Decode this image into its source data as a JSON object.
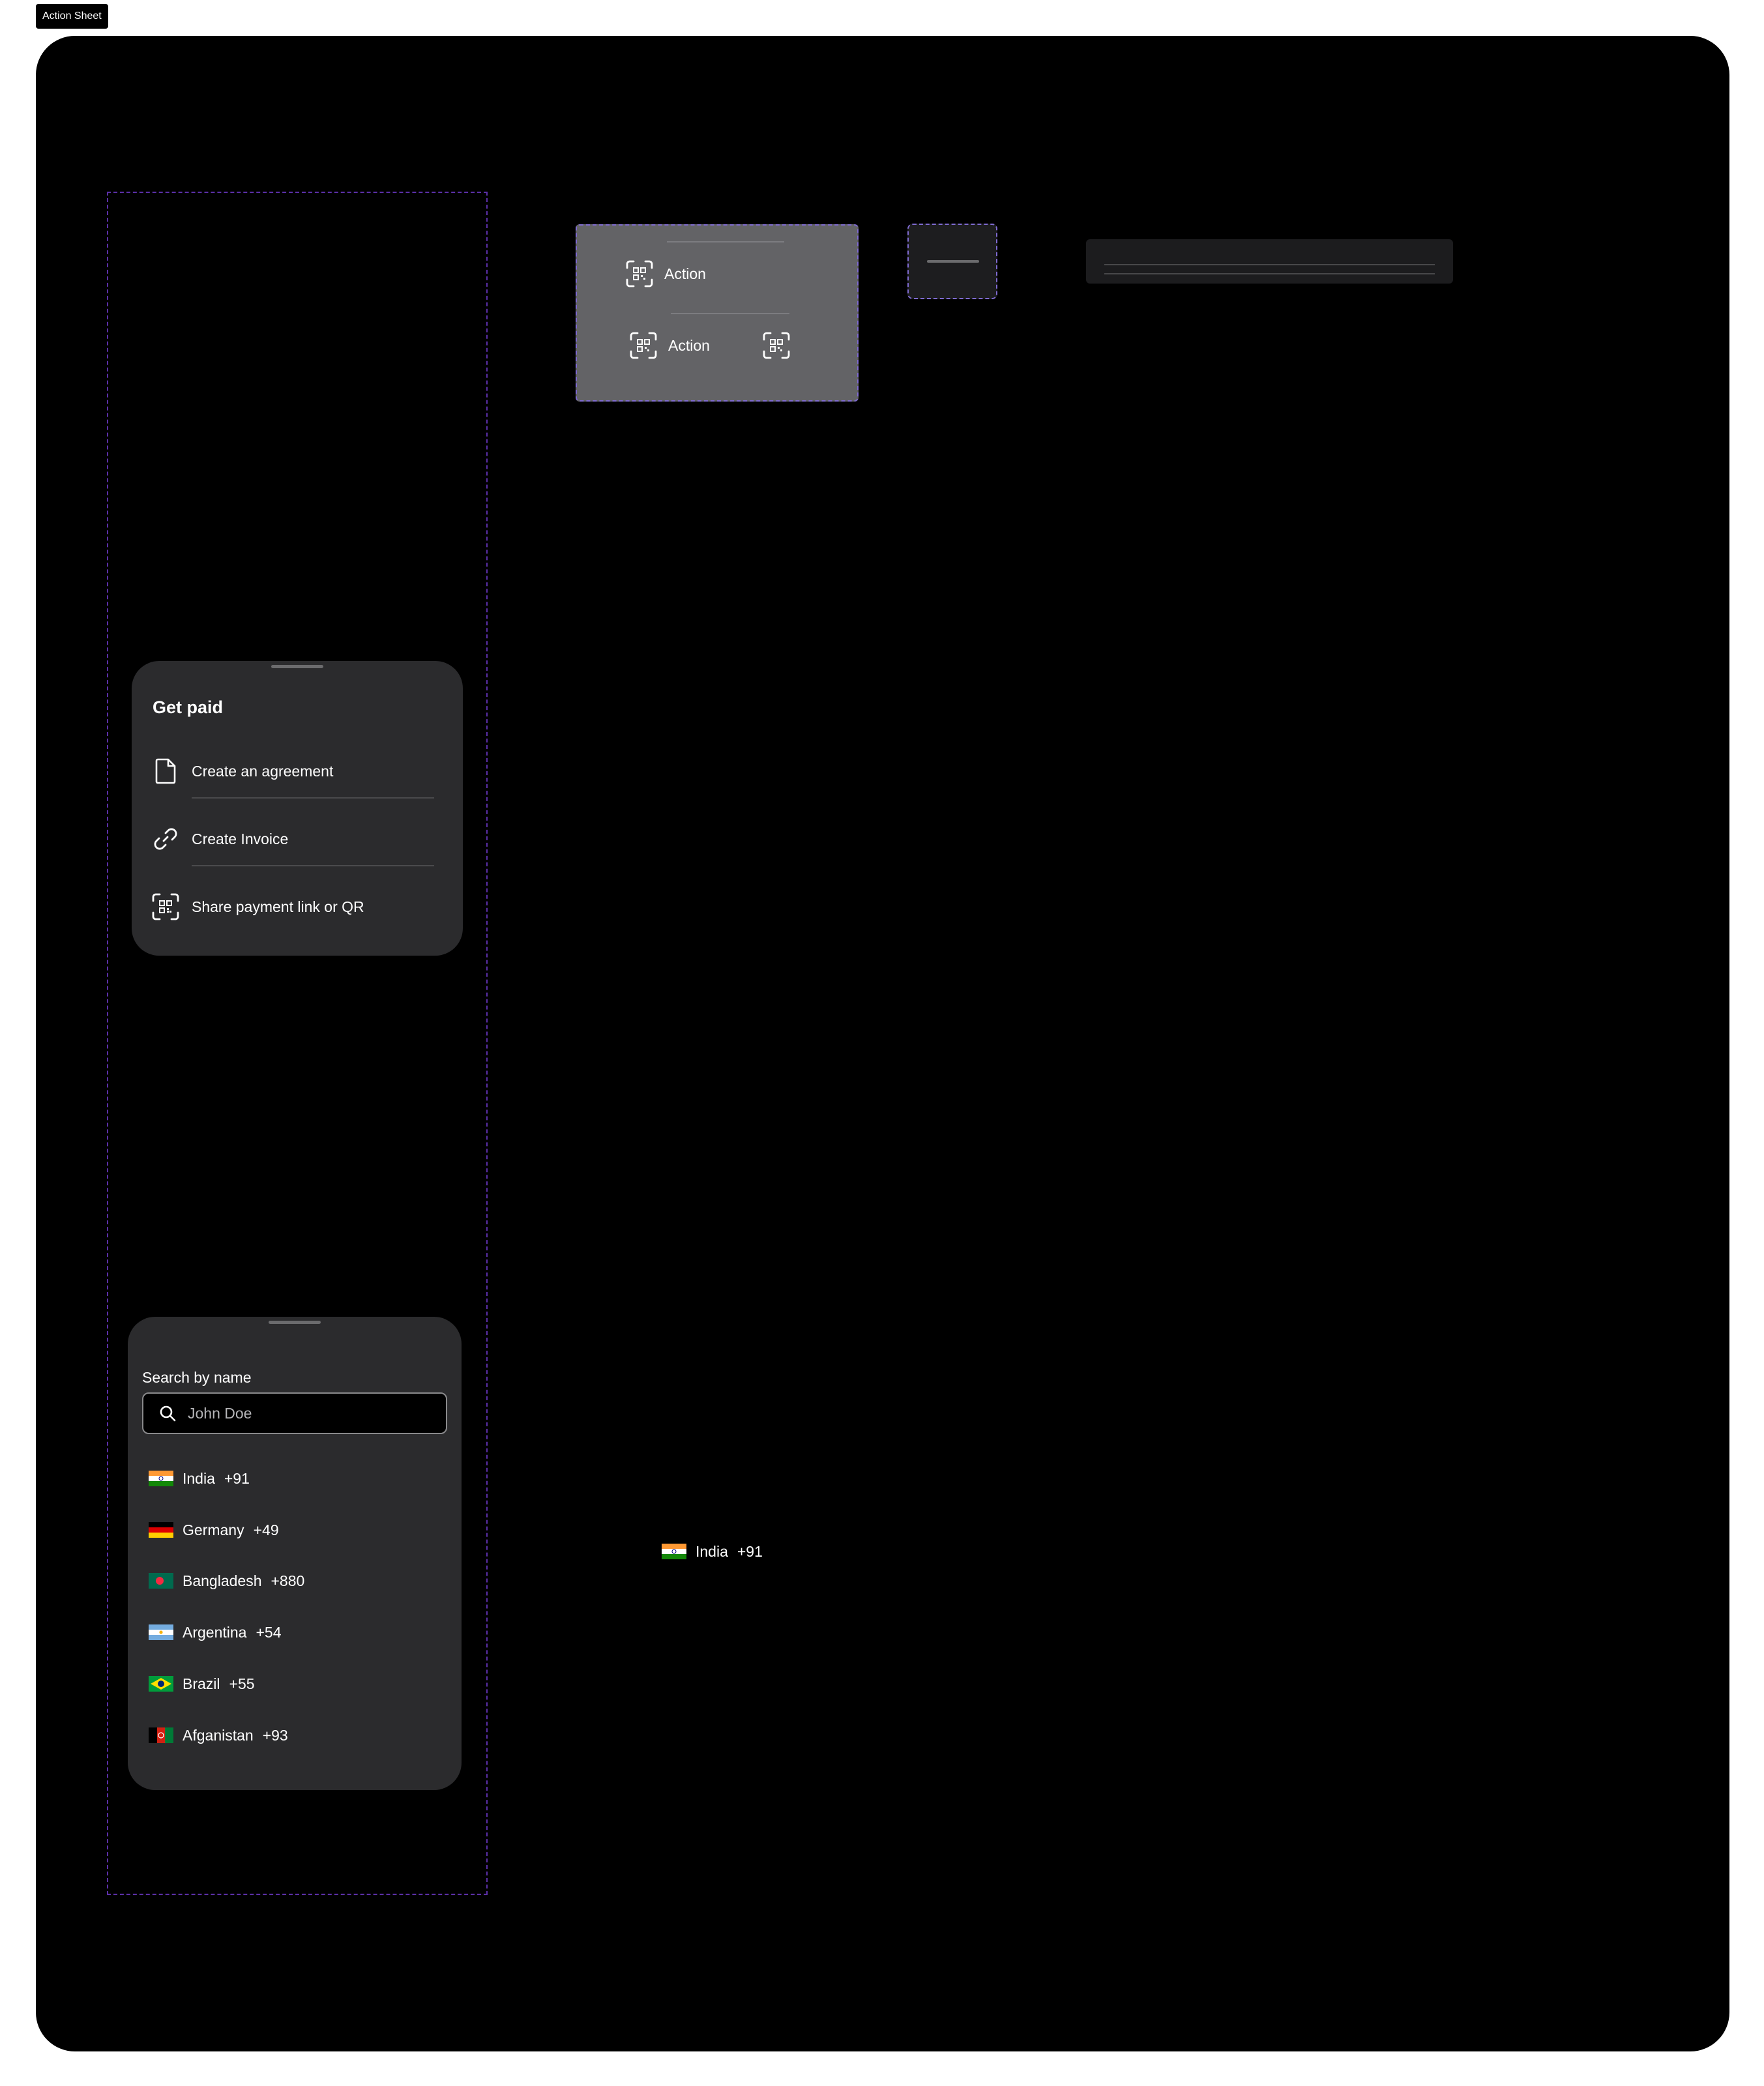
{
  "frame": {
    "label": "Action Sheet"
  },
  "get_paid_sheet": {
    "title": "Get paid",
    "items": [
      {
        "label": "Create an agreement",
        "icon": "document-icon"
      },
      {
        "label": "Create Invoice",
        "icon": "link-icon"
      },
      {
        "label": "Share payment link or QR",
        "icon": "qr-scan-icon"
      }
    ]
  },
  "country_sheet": {
    "search_label": "Search by name",
    "search_placeholder": "John Doe",
    "countries": [
      {
        "name": "India",
        "code": "+91",
        "flag": "india-flag-icon"
      },
      {
        "name": "Germany",
        "code": "+49",
        "flag": "germany-flag-icon"
      },
      {
        "name": "Bangladesh",
        "code": "+880",
        "flag": "bangladesh-flag-icon"
      },
      {
        "name": "Argentina",
        "code": "+54",
        "flag": "argentina-flag-icon"
      },
      {
        "name": "Brazil",
        "code": "+55",
        "flag": "brazil-flag-icon"
      },
      {
        "name": "Afganistan",
        "code": "+93",
        "flag": "afghanistan-flag-icon"
      }
    ]
  },
  "action_component": {
    "rows": [
      {
        "label": "Action",
        "icon": "qr-scan-icon"
      },
      {
        "label": "Action",
        "icon": "qr-scan-icon",
        "trailing_icon": "qr-scan-icon"
      }
    ]
  },
  "standalone_country_row": {
    "name": "India",
    "code": "+91",
    "flag": "india-flag-icon"
  },
  "colors": {
    "canvas": "#000000",
    "sheet": "#2b2b2d",
    "action_component": "#636366",
    "dashed_outline": "#5b2fa8",
    "text": "#ffffff"
  }
}
